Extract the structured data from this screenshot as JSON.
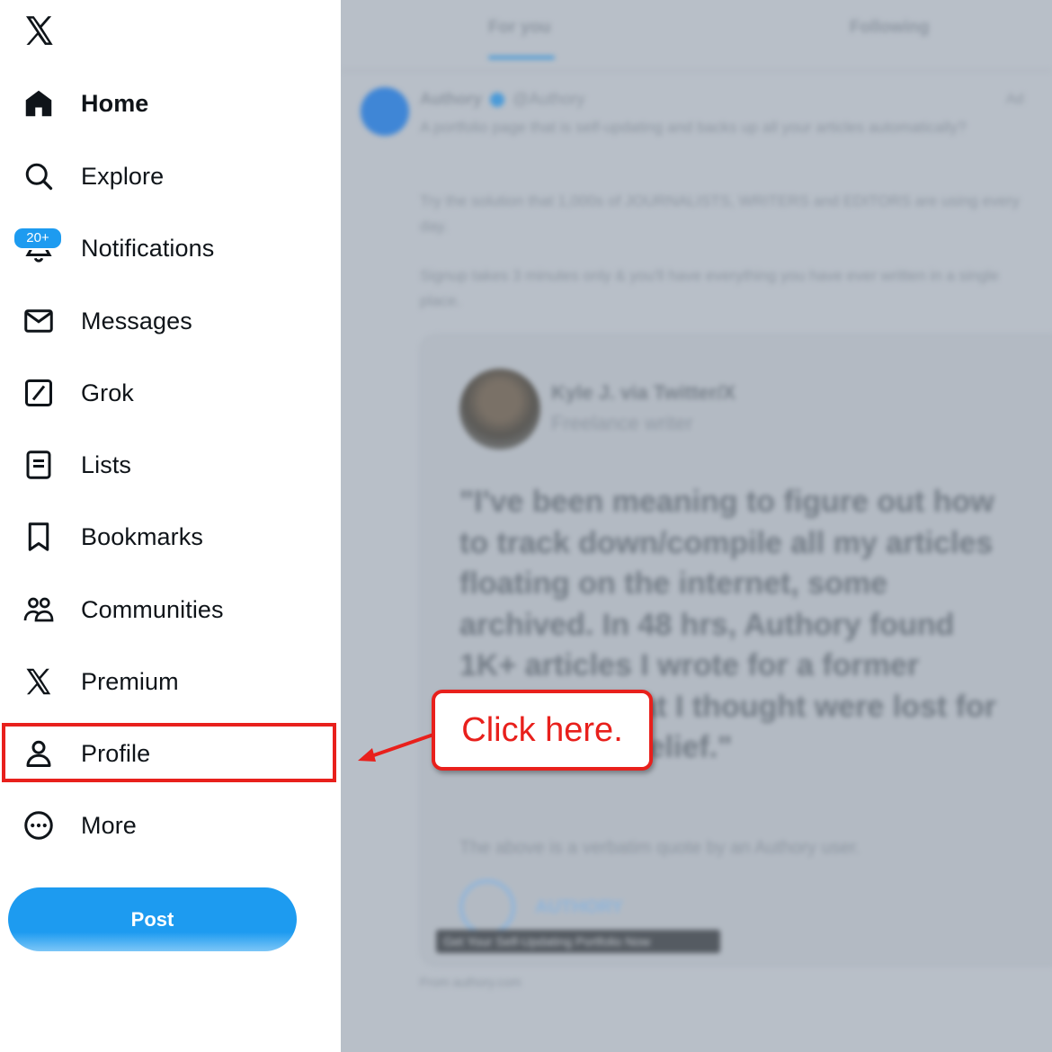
{
  "sidebar": {
    "logo_icon": "x-logo-icon",
    "items": [
      {
        "label": "Home",
        "icon": "home-icon"
      },
      {
        "label": "Explore",
        "icon": "search-icon"
      },
      {
        "label": "Notifications",
        "icon": "bell-icon",
        "badge": "20+"
      },
      {
        "label": "Messages",
        "icon": "envelope-icon"
      },
      {
        "label": "Grok",
        "icon": "grok-icon"
      },
      {
        "label": "Lists",
        "icon": "list-icon"
      },
      {
        "label": "Bookmarks",
        "icon": "bookmark-icon"
      },
      {
        "label": "Communities",
        "icon": "communities-icon"
      },
      {
        "label": "Premium",
        "icon": "x-premium-icon"
      },
      {
        "label": "Profile",
        "icon": "person-icon"
      },
      {
        "label": "More",
        "icon": "more-circle-icon"
      }
    ],
    "post_button": "Post"
  },
  "feed": {
    "tabs": [
      "For you",
      "Following"
    ],
    "post": {
      "author": "Authory",
      "handle": "@Authory",
      "ad_label": "Ad",
      "paragraphs": [
        "A portfolio page that is self-updating and backs up all your articles automatically?",
        "Try the solution that 1,000s of JOURNALISTS, WRITERS and EDITORS are using every day.",
        "Signup takes 3 minutes only & you'll have everything you have ever written in a single place."
      ],
      "card": {
        "name": "Kyle J. via Twitter/X",
        "subtitle": "Freelance writer",
        "quote": "\"I've been meaning to figure out how to track down/compile all my articles floating on the internet, some archived. In 48 hrs, Authory found 1K+ articles I wrote for a former employer, that I thought were lost for good. Huge relief.\"",
        "note": "The above is a verbatim quote by an Authory user.",
        "brand": "AUTHORY",
        "banner": "Get Your Self-Updating Portfolio Now",
        "footer": "From authory.com"
      }
    }
  },
  "annotation": {
    "callout_text": "Click here.",
    "color": "#e8201c"
  },
  "colors": {
    "accent": "#1d9bf0",
    "annotation": "#e8201c",
    "text": "#0f1419"
  }
}
